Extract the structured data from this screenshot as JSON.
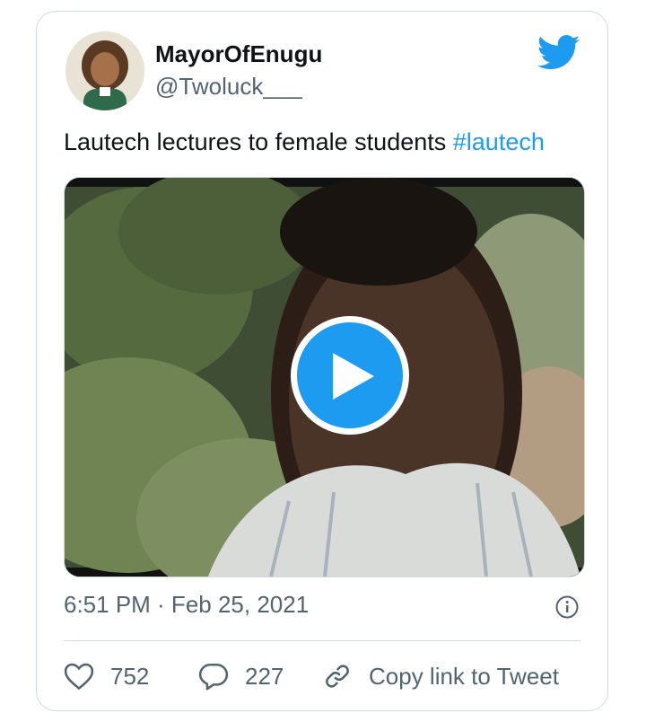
{
  "tweet": {
    "author_name": "MayorOfEnugu",
    "author_handle": "@Twoluck___",
    "text": "Lautech lectures to female students ",
    "hashtag": "#lautech",
    "timestamp": "6:51 PM · Feb 25, 2021",
    "likes": "752",
    "replies": "227",
    "copy_link_label": "Copy link to Tweet"
  },
  "icons": {
    "brand": "twitter-bird-icon",
    "play": "play-icon",
    "info": "info-icon",
    "like": "heart-icon",
    "reply": "reply-bubble-icon",
    "copy": "link-icon"
  },
  "colors": {
    "accent": "#1d9bf0",
    "text": "#0f1419",
    "secondary": "#536471",
    "border": "#cfd9de"
  }
}
